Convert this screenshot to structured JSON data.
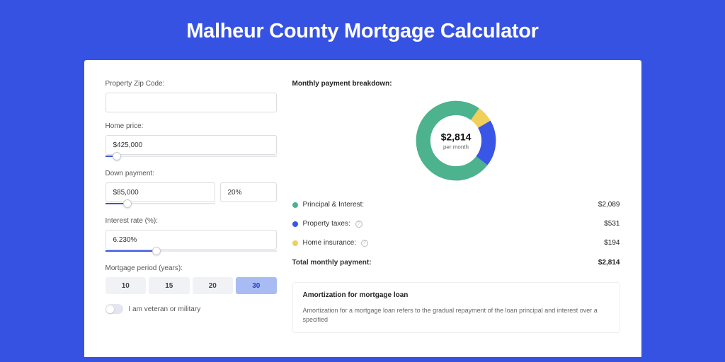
{
  "page_title": "Malheur County Mortgage Calculator",
  "form": {
    "zip_label": "Property Zip Code:",
    "zip_value": "",
    "home_price_label": "Home price:",
    "home_price_value": "$425,000",
    "home_price_slider_pct": 7,
    "down_payment_label": "Down payment:",
    "down_payment_amount": "$85,000",
    "down_payment_pct": "20%",
    "down_payment_slider_pct": 20,
    "interest_label": "Interest rate (%):",
    "interest_value": "6.230%",
    "interest_slider_pct": 30,
    "period_label": "Mortgage period (years):",
    "periods": [
      "10",
      "15",
      "20",
      "30"
    ],
    "period_selected": "30",
    "veteran_label": "I am veteran or military",
    "veteran_on": false
  },
  "breakdown": {
    "title": "Monthly payment breakdown:",
    "donut": {
      "amount": "$2,814",
      "sub": "per month",
      "segments": [
        {
          "name": "principal_interest",
          "color": "#4db28e",
          "value": 2089
        },
        {
          "name": "property_taxes",
          "color": "#3a56e6",
          "value": 531
        },
        {
          "name": "home_insurance",
          "color": "#f0cf5a",
          "value": 194
        }
      ],
      "total": 2814
    },
    "items": [
      {
        "dot": "green",
        "label": "Principal & Interest:",
        "info": false,
        "value": "$2,089"
      },
      {
        "dot": "blue",
        "label": "Property taxes:",
        "info": true,
        "value": "$531"
      },
      {
        "dot": "yellow",
        "label": "Home insurance:",
        "info": true,
        "value": "$194"
      }
    ],
    "total_label": "Total monthly payment:",
    "total_value": "$2,814"
  },
  "amortization": {
    "title": "Amortization for mortgage loan",
    "text": "Amortization for a mortgage loan refers to the gradual repayment of the loan principal and interest over a specified"
  },
  "chart_data": {
    "type": "pie",
    "title": "Monthly payment breakdown",
    "series": [
      {
        "name": "Principal & Interest",
        "value": 2089,
        "color": "#4db28e"
      },
      {
        "name": "Property taxes",
        "value": 531,
        "color": "#3a56e6"
      },
      {
        "name": "Home insurance",
        "value": 194,
        "color": "#f0cf5a"
      }
    ],
    "total": 2814,
    "center_label": "$2,814 per month"
  }
}
